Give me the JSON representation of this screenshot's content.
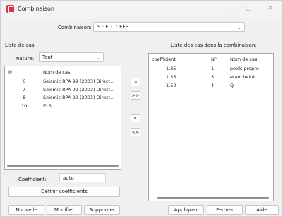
{
  "window": {
    "title": "Combinaison",
    "minimize_icon": "minimize-icon",
    "maximize_icon": "maximize-icon",
    "close_icon": "close-icon"
  },
  "combinaison": {
    "label": "Combinaison:",
    "value": "9 : ELU : EFF"
  },
  "left": {
    "title": "Liste de cas:",
    "nature_label": "Nature:",
    "nature_value": "Tout",
    "columns": [
      "N°",
      "Nom de cas"
    ],
    "rows": [
      {
        "no": "6",
        "name": "Seismic RPA 99 (2003) Direct..."
      },
      {
        "no": "7",
        "name": "Seismic RPA 99 (2003) Direct..."
      },
      {
        "no": "8",
        "name": "Seismic RPA 99 (2003) Direct..."
      },
      {
        "no": "10",
        "name": "ELS"
      }
    ],
    "coef_label": "Coefficient:",
    "coef_value": "auto",
    "define_button": "Définir coefficients"
  },
  "right": {
    "title": "Liste des cas dans la combinaison:",
    "columns": [
      "coefficient",
      "N°",
      "Nom de cas"
    ],
    "rows": [
      {
        "coef": "1.35",
        "no": "1",
        "name": "poids propre"
      },
      {
        "coef": "1.35",
        "no": "3",
        "name": "etancheité"
      },
      {
        "coef": "1.50",
        "no": "4",
        "name": "Q"
      }
    ]
  },
  "transfer": {
    "add_one": ">",
    "add_all": ">>",
    "remove_one": "<",
    "remove_all": "<<"
  },
  "footer": {
    "new": "Nouvelle",
    "modify": "Modifier",
    "delete": "Supprimer",
    "apply": "Appliquer",
    "close": "Fermer",
    "help": "Aide"
  },
  "colors": {
    "accent": "#d9344a",
    "background": "#f0f0f0"
  }
}
